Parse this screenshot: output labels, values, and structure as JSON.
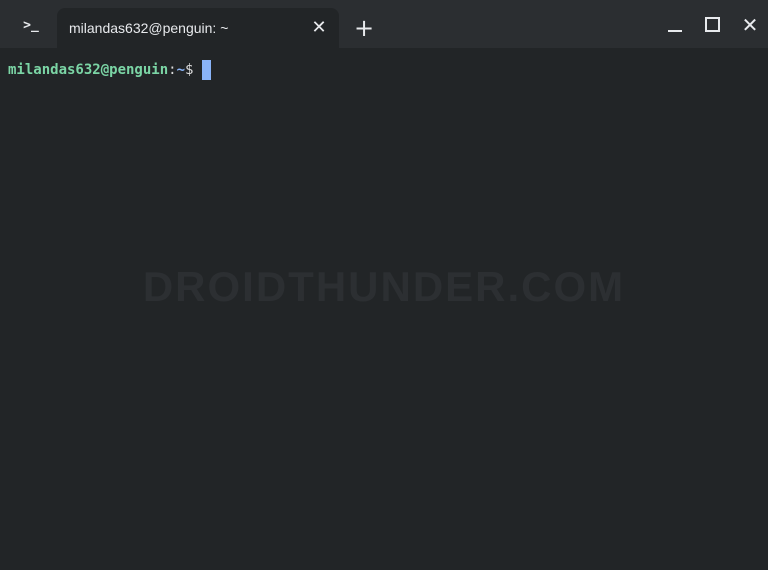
{
  "titlebar": {
    "app_icon_glyph": ">_",
    "tab": {
      "title": "milandas632@penguin: ~",
      "close_glyph": "✕"
    },
    "new_tab_glyph": "+",
    "close_glyph": "✕"
  },
  "terminal": {
    "prompt": {
      "user_host": "milandas632@penguin",
      "separator": ":",
      "path": "~",
      "symbol": "$"
    }
  },
  "watermark": "DROIDTHUNDER.COM",
  "colors": {
    "background": "#222527",
    "titlebar": "#2b2e31",
    "prompt_user": "#7bd5a5",
    "prompt_path": "#8ab4f8",
    "cursor": "#8ab4f8"
  }
}
